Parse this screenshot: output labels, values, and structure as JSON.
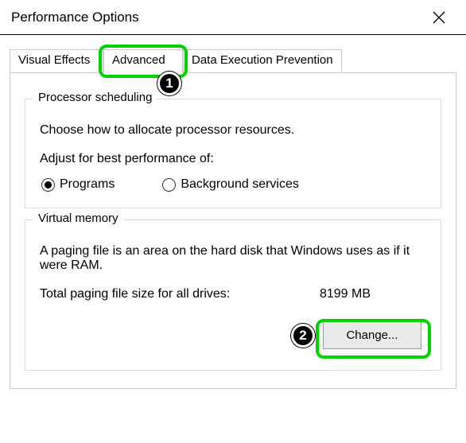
{
  "window": {
    "title": "Performance Options"
  },
  "tabs": {
    "visual_effects": "Visual Effects",
    "advanced": "Advanced",
    "dep": "Data Execution Prevention"
  },
  "annotations": {
    "one": "1",
    "two": "2"
  },
  "processor": {
    "legend": "Processor scheduling",
    "intro": "Choose how to allocate processor resources.",
    "adjust_label": "Adjust for best performance of:",
    "programs": "Programs",
    "background": "Background services"
  },
  "virtual_memory": {
    "legend": "Virtual memory",
    "desc": "A paging file is an area on the hard disk that Windows uses as if it were RAM.",
    "total_label": "Total paging file size for all drives:",
    "total_value": "8199 MB",
    "change_btn": "Change..."
  }
}
